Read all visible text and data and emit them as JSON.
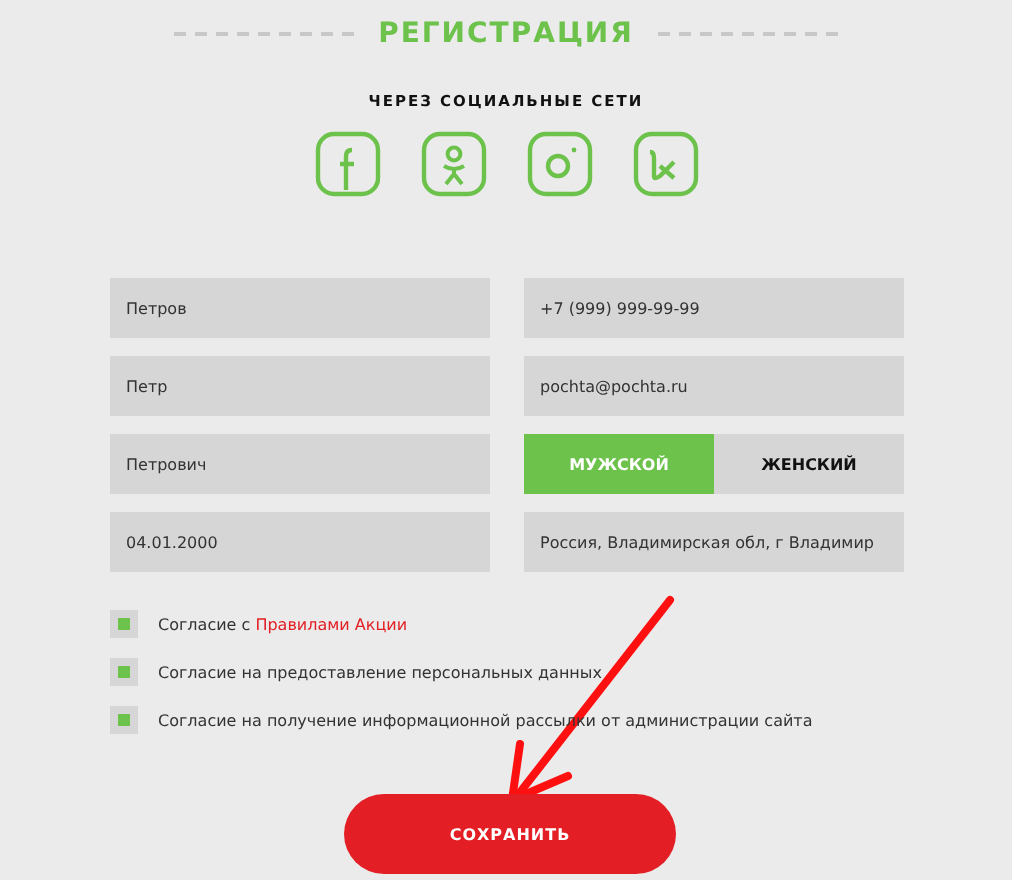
{
  "title": "РЕГИСТРАЦИЯ",
  "social": {
    "heading": "ЧЕРЕЗ СОЦИАЛЬНЫЕ СЕТИ",
    "icons": [
      {
        "kind": "facebook"
      },
      {
        "kind": "odnoklassniki"
      },
      {
        "kind": "instagram"
      },
      {
        "kind": "vk"
      }
    ]
  },
  "fields": [
    {
      "kind": "input",
      "value": "Петров"
    },
    {
      "kind": "input",
      "value": "+7 (999) 999-99-99"
    },
    {
      "kind": "input",
      "value": "Петр"
    },
    {
      "kind": "input",
      "value": "pochta@pochta.ru"
    },
    {
      "kind": "input",
      "value": "Петрович"
    },
    {
      "kind": "toggle",
      "options": [
        {
          "label": "МУЖСКОЙ",
          "selected": true
        },
        {
          "label": "ЖЕНСКИЙ",
          "selected": false
        }
      ]
    },
    {
      "kind": "input",
      "value": "04.01.2000"
    },
    {
      "kind": "input",
      "value": "Россия, Владимирская обл, г Владимир"
    }
  ],
  "consents": [
    {
      "text": "Согласие с ",
      "link": "Правилами Акции",
      "checked": true
    },
    {
      "text": "Согласие на предоставление персональных данных",
      "checked": true
    },
    {
      "text": "Согласие на получение информационной рассылки от администрации сайта",
      "checked": true
    }
  ],
  "save_button": "СОХРАНИТЬ"
}
